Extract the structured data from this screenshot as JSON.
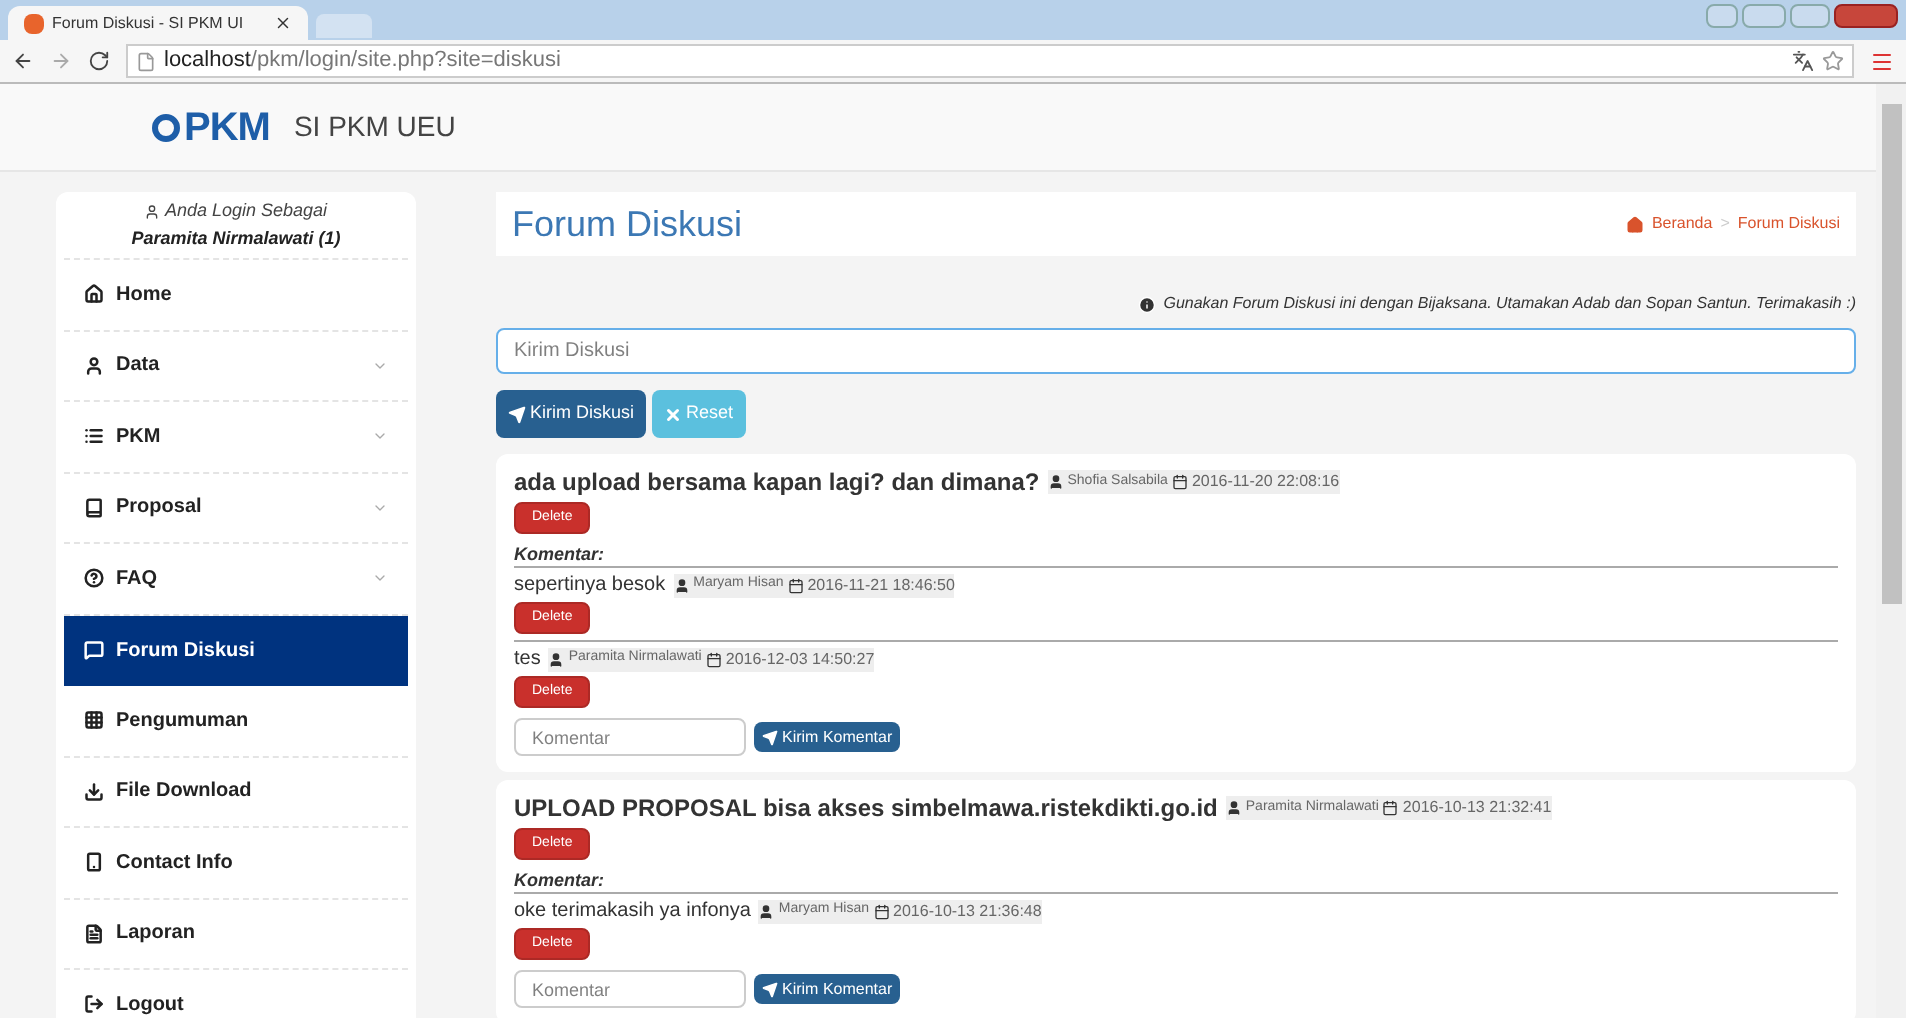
{
  "browser": {
    "tab_title": "Forum Diskusi - SI PKM UI",
    "url_host": "localhost",
    "url_path": "/pkm/login/site.php?site=diskusi"
  },
  "header": {
    "logo_text": "PKM",
    "site_name": "SI PKM UEU"
  },
  "sidebar": {
    "login_label": "Anda Login Sebagai",
    "user": "Paramita Nirmalawati (1)",
    "items": [
      {
        "label": "Home",
        "expandable": false,
        "selected": false
      },
      {
        "label": "Data",
        "expandable": true,
        "selected": false
      },
      {
        "label": "PKM",
        "expandable": true,
        "selected": false
      },
      {
        "label": "Proposal",
        "expandable": true,
        "selected": false
      },
      {
        "label": "FAQ",
        "expandable": true,
        "selected": false
      },
      {
        "label": "Forum Diskusi",
        "expandable": false,
        "selected": true
      },
      {
        "label": "Pengumuman",
        "expandable": false,
        "selected": false
      },
      {
        "label": "File Download",
        "expandable": false,
        "selected": false
      },
      {
        "label": "Contact Info",
        "expandable": false,
        "selected": false
      },
      {
        "label": "Laporan",
        "expandable": false,
        "selected": false
      },
      {
        "label": "Logout",
        "expandable": false,
        "selected": false
      }
    ]
  },
  "page": {
    "title": "Forum Diskusi",
    "breadcrumb": [
      "Beranda",
      "Forum Diskusi"
    ],
    "breadcrumb_separator": ">",
    "notice": "Gunakan Forum Diskusi ini dengan Bijaksana. Utamakan Adab dan Sopan Santun. Terimakasih :)",
    "input": {
      "placeholder": "Kirim Diskusi"
    },
    "send_button": "Kirim Diskusi",
    "reset_button": "Reset"
  },
  "posts": [
    {
      "title": "ada upload bersama kapan lagi? dan dimana?",
      "author": "Shofia Salsabila",
      "date": "2016-11-20 22:08:16",
      "delete": "Delete",
      "comments_label": "Komentar:",
      "comments": [
        {
          "text": "sepertinya besok",
          "author": "Maryam Hisan",
          "date": "2016-11-21 18:46:50",
          "delete": "Delete"
        },
        {
          "text": "tes",
          "author": "Paramita Nirmalawati",
          "date": "2016-12-03 14:50:27",
          "delete": "Delete"
        }
      ],
      "comment_placeholder": "Komentar",
      "comment_button": "Kirim Komentar"
    },
    {
      "title": "UPLOAD PROPOSAL bisa akses simbelmawa.ristekdikti.go.id",
      "author": "Paramita Nirmalawati",
      "date": "2016-10-13 21:32:41",
      "delete": "Delete",
      "comments_label": "Komentar:",
      "comments": [
        {
          "text": "oke terimakasih ya infonya",
          "author": "Maryam Hisan",
          "date": "2016-10-13 21:36:48",
          "delete": "Delete"
        }
      ],
      "comment_placeholder": "Komentar",
      "comment_button": "Kirim Komentar"
    }
  ]
}
